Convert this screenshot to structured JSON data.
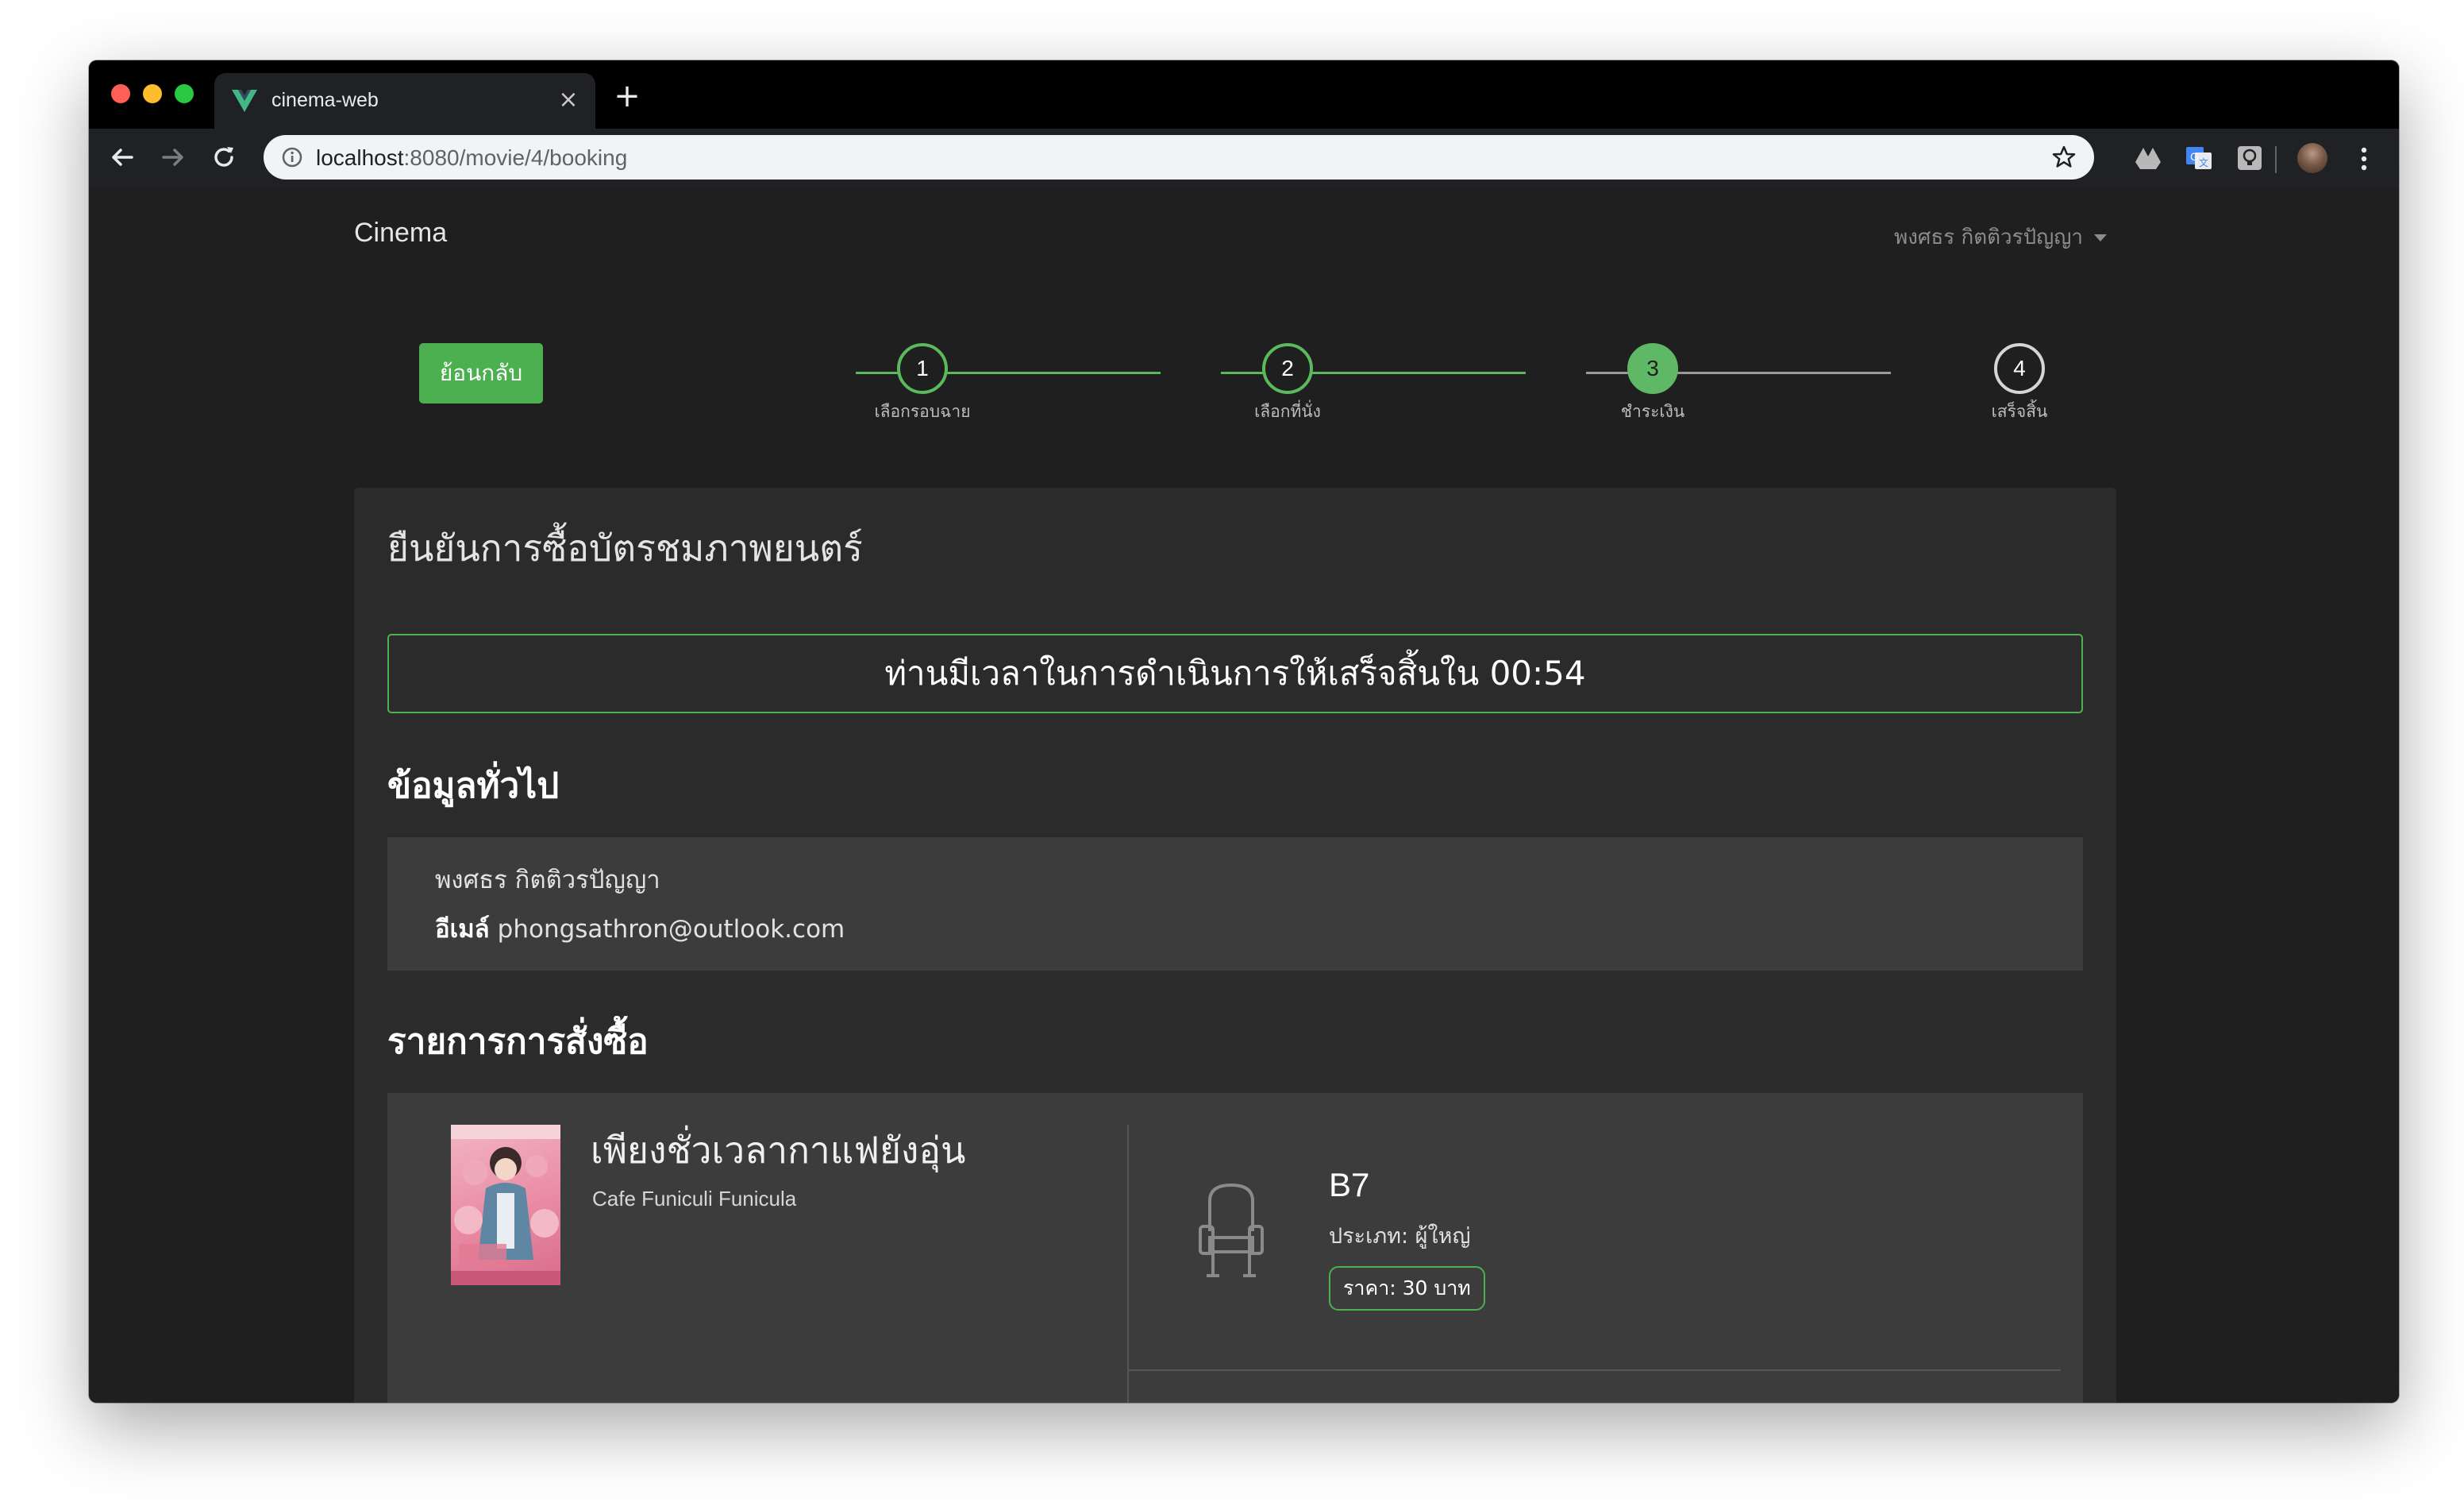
{
  "browser": {
    "tab_title": "cinema-web",
    "tab_close": "×",
    "new_tab": "+",
    "url_host": "localhost",
    "url_rest": ":8080/movie/4/booking"
  },
  "nav": {
    "brand": "Cinema",
    "user_name": "พงศธร กิตติวรปัญญา"
  },
  "back_button": "ย้อนกลับ",
  "stepper": {
    "steps": [
      {
        "number": "1",
        "label": "เลือกรอบฉาย",
        "state": "done"
      },
      {
        "number": "2",
        "label": "เลือกที่นั่ง",
        "state": "done"
      },
      {
        "number": "3",
        "label": "ชำระเงิน",
        "state": "active"
      },
      {
        "number": "4",
        "label": "เสร็จสิ้น",
        "state": "pending"
      }
    ],
    "colors": {
      "done": "#5cb85c",
      "pending": "#d5d5d5"
    }
  },
  "confirm": {
    "title": "ยืนยันการซื้อบัตรชมภาพยนตร์",
    "timer_text": "ท่านมีเวลาในการดำเนินการให้เสร็จสิ้นใน 00:54"
  },
  "general_info": {
    "heading": "ข้อมูลทั่วไป",
    "name": "พงศธร กิตติวรปัญญา",
    "email_label": "อีเมล์",
    "email": "phongsathron@outlook.com"
  },
  "order": {
    "heading": "รายการการสั่งซื้อ",
    "movie_title": "เพียงชั่วเวลากาแฟยังอุ่น",
    "movie_subtitle": "Cafe Funiculi Funicula",
    "seat_code": "B7",
    "seat_type": "ประเภท: ผู้ใหญ่",
    "price": "ราคา: 30 บาท"
  },
  "accent_color": "#4caf50"
}
